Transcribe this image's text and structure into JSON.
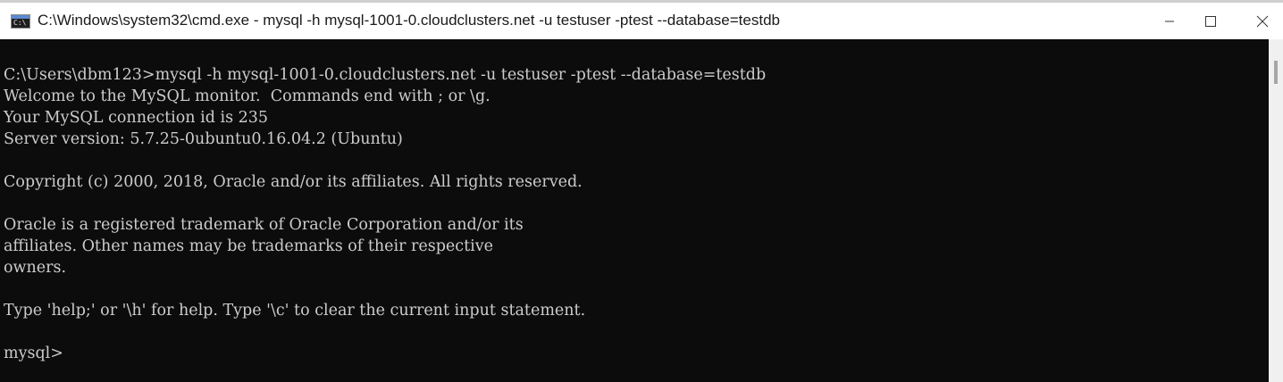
{
  "window": {
    "title": "C:\\Windows\\system32\\cmd.exe - mysql  -h mysql-1001-0.cloudclusters.net -u testuser -ptest --database=testdb",
    "icon": "cmd-icon",
    "controls": [
      "minimize-icon",
      "maximize-icon",
      "close-icon"
    ]
  },
  "console": {
    "lines": [
      "C:\\Users\\dbm123>mysql -h mysql-1001-0.cloudclusters.net -u testuser -ptest --database=testdb",
      "Welcome to the MySQL monitor.  Commands end with ; or \\g.",
      "Your MySQL connection id is 235",
      "Server version: 5.7.25-0ubuntu0.16.04.2 (Ubuntu)",
      "",
      "Copyright (c) 2000, 2018, Oracle and/or its affiliates. All rights reserved.",
      "",
      "Oracle is a registered trademark of Oracle Corporation and/or its",
      "affiliates. Other names may be trademarks of their respective",
      "owners.",
      "",
      "Type 'help;' or '\\h' for help. Type '\\c' to clear the current input statement.",
      "",
      "mysql>"
    ]
  },
  "colors": {
    "console_bg": "#0c0c0c",
    "console_fg": "#cccccc",
    "titlebar_bg": "#ffffff"
  }
}
